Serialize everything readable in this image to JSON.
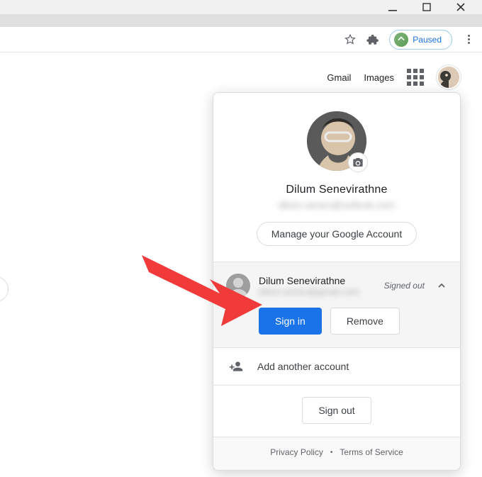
{
  "window": {
    "minimize": "Minimize",
    "maximize": "Maximize",
    "close": "Close"
  },
  "toolbar": {
    "paused_label": "Paused"
  },
  "nav": {
    "gmail": "Gmail",
    "images": "Images"
  },
  "account": {
    "main_name": "Dilum Senevirathne",
    "main_email": "dilum.senev@outlook.com",
    "manage_label": "Manage your Google Account",
    "other": {
      "name": "Dilum Senevirathne",
      "email": "dilum.senev@gmail.com",
      "status": "Signed out",
      "sign_in_label": "Sign in",
      "remove_label": "Remove"
    },
    "add_label": "Add another account",
    "signout_label": "Sign out",
    "privacy_label": "Privacy Policy",
    "tos_label": "Terms of Service"
  }
}
